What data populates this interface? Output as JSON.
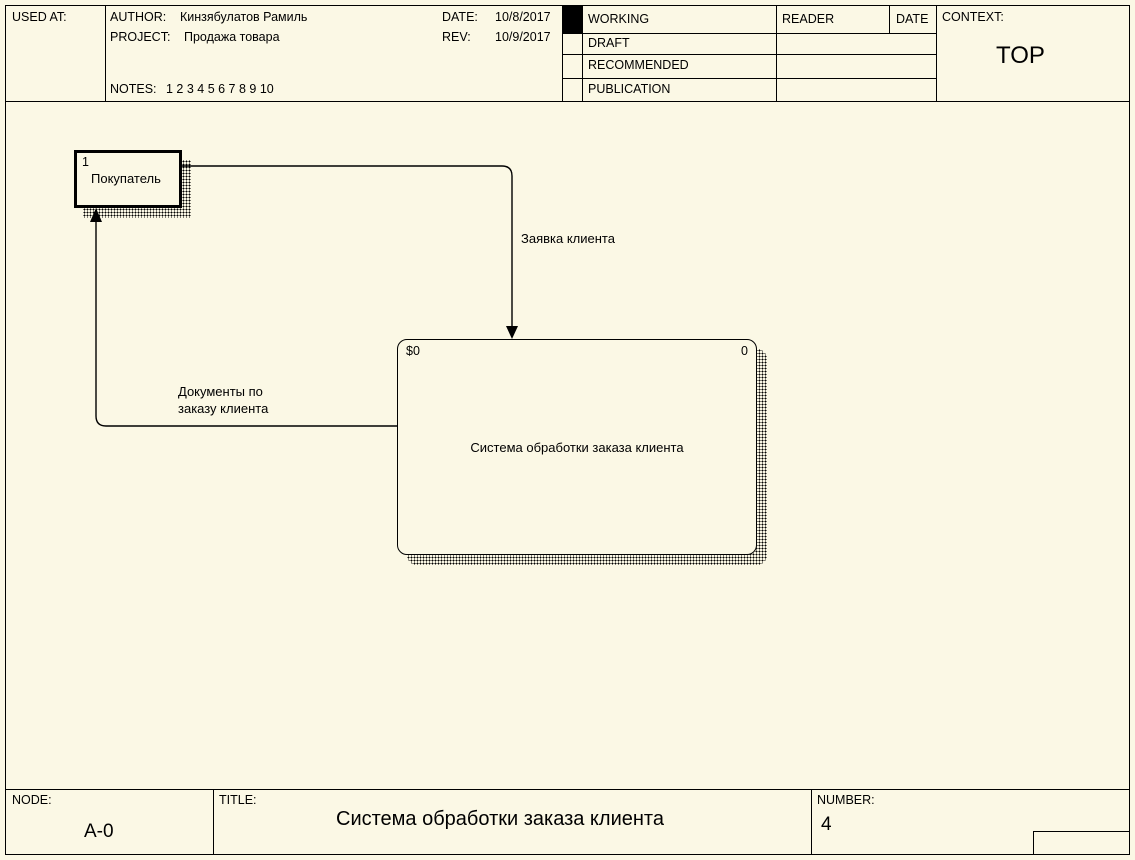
{
  "header": {
    "used_at_label": "USED AT:",
    "author_label": "AUTHOR:",
    "author": "Кинзябулатов Рамиль",
    "project_label": "PROJECT:",
    "project": "Продажа товара",
    "date_label": "DATE:",
    "date": "10/8/2017",
    "rev_label": "REV:",
    "rev": "10/9/2017",
    "notes_label": "NOTES:",
    "notes": "1  2  3  4  5  6  7  8  9  10",
    "working": "WORKING",
    "draft": "DRAFT",
    "recommended": "RECOMMENDED",
    "publication": "PUBLICATION",
    "reader": "READER",
    "date2": "DATE",
    "context": "CONTEXT:",
    "context_value": "TOP"
  },
  "diagram": {
    "actor_num": "1",
    "actor_label": "Покупатель",
    "arrow1_label": "Заявка клиента",
    "arrow2_line1": "Документы по",
    "arrow2_line2": "заказу клиента",
    "process_left_tag": "$0",
    "process_right_tag": "0",
    "process_label": "Система обработки заказа клиента"
  },
  "footer": {
    "node_label": "NODE:",
    "node": "A-0",
    "title_label": "TITLE:",
    "title": "Система обработки заказа клиента",
    "number_label": "NUMBER:",
    "number": "4"
  }
}
